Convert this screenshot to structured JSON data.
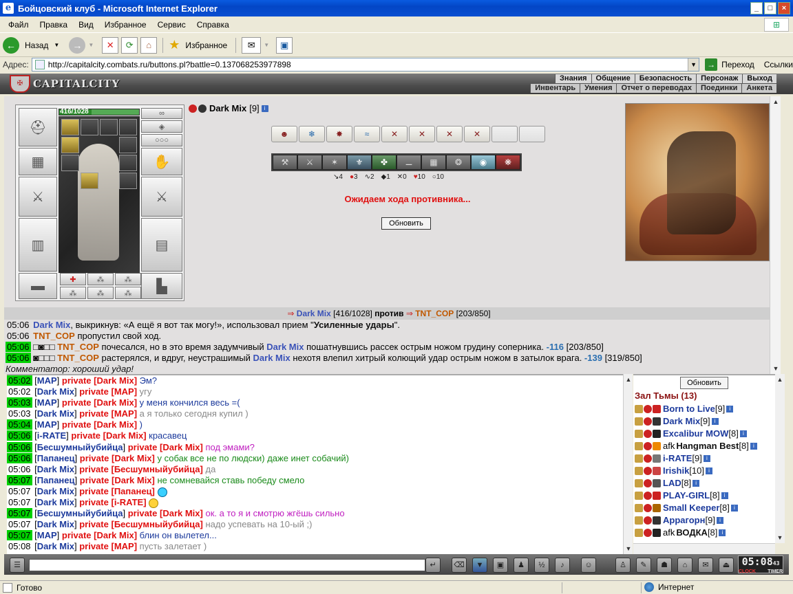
{
  "window": {
    "title": "Бойцовский клуб - Microsoft Internet Explorer"
  },
  "menu": [
    "Файл",
    "Правка",
    "Вид",
    "Избранное",
    "Сервис",
    "Справка"
  ],
  "toolbar": {
    "back_label": "Назад",
    "favorites_label": "Избранное"
  },
  "address": {
    "label": "Адрес:",
    "url": "http://capitalcity.combats.ru/buttons.pl?battle=0.137068253977898",
    "go_label": "Переход",
    "links_label": "Ссылки"
  },
  "game_header": {
    "logo_text": "CAPITALCITY",
    "nav_top": [
      "Знания",
      "Общение",
      "Безопасность",
      "Персонаж",
      "Выход"
    ],
    "nav_bottom": [
      "Инвентарь",
      "Умения",
      "Отчет о переводах",
      "Поединки",
      "Анкета"
    ]
  },
  "player": {
    "hp_text": "416/1028",
    "hp_fraction": 0.405,
    "name": "Dark Mix",
    "level": "[9]"
  },
  "counters": [
    "4",
    "3",
    "2",
    "1",
    "0",
    "10",
    "10"
  ],
  "status_message": "Ожидаем хода противника...",
  "refresh_label": "Обновить",
  "vs_bar": {
    "p1": "Dark Mix",
    "p1_hp": "[416/1028]",
    "vs": "против",
    "p2": "TNT_COP",
    "p2_hp": "[203/850]"
  },
  "battle_log": [
    {
      "time": "05:06",
      "hl": false,
      "parts": [
        [
          "blue",
          "Dark Mix"
        ],
        [
          "n",
          ", выкрикнув: «А ещё я вот так могу!», использовал прием \""
        ],
        [
          "dark",
          "Усиленные удары"
        ],
        [
          "n",
          "\"."
        ]
      ]
    },
    {
      "time": "05:06",
      "hl": false,
      "parts": [
        [
          "orange",
          "TNT_COP"
        ],
        [
          "n",
          " пропустил свой ход."
        ]
      ]
    },
    {
      "time": "05:06",
      "hl": true,
      "parts": [
        [
          "n",
          "□◙□□ "
        ],
        [
          "orange",
          "TNT_COP"
        ],
        [
          "n",
          " почесался, но в это время задумчивый "
        ],
        [
          "blue",
          "Dark Mix"
        ],
        [
          "n",
          " пошатнувшись рассек острым ножом грудину соперника. "
        ],
        [
          "cyan",
          "-116"
        ],
        [
          "n",
          " [203/850]"
        ]
      ]
    },
    {
      "time": "05:06",
      "hl": true,
      "parts": [
        [
          "n",
          "◙□□□ "
        ],
        [
          "orange",
          "TNT_COP"
        ],
        [
          "n",
          " растерялся, и вдруг, неустрашимый "
        ],
        [
          "blue",
          "Dark Mix"
        ],
        [
          "n",
          " нехотя влепил хитрый колющий удар острым ножом в затылок врага. "
        ],
        [
          "cyan",
          "-139"
        ],
        [
          "n",
          " [319/850]"
        ]
      ]
    }
  ],
  "commentator": "Комментатор: хороший удар!",
  "chat": [
    {
      "time": "05:02",
      "hl": true,
      "from": "MAP",
      "to": "Dark Mix",
      "msg": "Эм?",
      "color": "#1c3a9c",
      "smile": ""
    },
    {
      "time": "05:02",
      "hl": false,
      "from": "Dark Mix",
      "to": "MAP",
      "msg": "угу",
      "color": "#888",
      "smile": ""
    },
    {
      "time": "05:03",
      "hl": true,
      "from": "MAP",
      "to": "Dark Mix",
      "msg": "у меня кончился весь =(",
      "color": "#1c3a9c",
      "smile": ""
    },
    {
      "time": "05:03",
      "hl": false,
      "from": "Dark Mix",
      "to": "MAP",
      "msg": "а я только сегодня купил )",
      "color": "#888",
      "smile": ""
    },
    {
      "time": "05:04",
      "hl": true,
      "from": "MAP",
      "to": "Dark Mix",
      "msg": ")",
      "color": "#1c3a9c",
      "smile": ""
    },
    {
      "time": "05:06",
      "hl": true,
      "from": "i-RATE",
      "to": "Dark Mix",
      "msg": "красавец",
      "color": "#1c3a9c",
      "smile": ""
    },
    {
      "time": "05:06",
      "hl": true,
      "from": "Бесшумныйубийца",
      "to": "Dark Mix",
      "msg": "под эмами?",
      "color": "#c020c0",
      "smile": ""
    },
    {
      "time": "05:06",
      "hl": true,
      "from": "Папанец",
      "to": "Dark Mix",
      "msg": "у собак все не по людски) даже инет собачий)",
      "color": "#1a8a1a",
      "smile": ""
    },
    {
      "time": "05:06",
      "hl": false,
      "from": "Dark Mix",
      "to": "Бесшумныйубийца",
      "msg": "да",
      "color": "#888",
      "smile": ""
    },
    {
      "time": "05:07",
      "hl": true,
      "from": "Папанец",
      "to": "Dark Mix",
      "msg": "не сомневайся ставь победу смело",
      "color": "#1a8a1a",
      "smile": ""
    },
    {
      "time": "05:07",
      "hl": false,
      "from": "Dark Mix",
      "to": "Папанец",
      "msg": "",
      "color": "#888",
      "smile": "blue2"
    },
    {
      "time": "05:07",
      "hl": false,
      "from": "Dark Mix",
      "to": "i-RATE",
      "msg": "",
      "color": "#888",
      "smile": "yellow"
    },
    {
      "time": "05:07",
      "hl": true,
      "from": "Бесшумныйубийца",
      "to": "Dark Mix",
      "msg": "ок. а то я и смотрю жгёшь сильно",
      "color": "#c020c0",
      "smile": ""
    },
    {
      "time": "05:07",
      "hl": false,
      "from": "Dark Mix",
      "to": "Бесшумныйубийца",
      "msg": "надо успевать на 10-ый ;)",
      "color": "#888",
      "smile": ""
    },
    {
      "time": "05:07",
      "hl": true,
      "from": "MAP",
      "to": "Dark Mix",
      "msg": "блин он вылетел...",
      "color": "#1c3a9c",
      "smile": ""
    },
    {
      "time": "05:08",
      "hl": false,
      "from": "Dark Mix",
      "to": "MAP",
      "msg": "пусть залетает )",
      "color": "#888",
      "smile": ""
    }
  ],
  "chat_private_word": "private",
  "room": {
    "title": "Зал Тьмы (13)",
    "users": [
      {
        "name": "Born to Live",
        "level": "[9]",
        "afk": "",
        "black": false
      },
      {
        "name": "Dark Mix",
        "level": "[9]",
        "afk": "",
        "black": false
      },
      {
        "name": "Excalibur MOW",
        "level": "[8]",
        "afk": "",
        "black": false
      },
      {
        "name": "Hangman Best",
        "level": "[8]",
        "afk": "afk ",
        "black": true
      },
      {
        "name": "i-RATE",
        "level": "[9]",
        "afk": "",
        "black": false
      },
      {
        "name": "Irishik",
        "level": "[10]",
        "afk": "",
        "black": false
      },
      {
        "name": "LAD",
        "level": "[8]",
        "afk": "",
        "black": false
      },
      {
        "name": "PLAY-GIRL",
        "level": "[8]",
        "afk": "",
        "black": false
      },
      {
        "name": "Small Keeper",
        "level": "[8]",
        "afk": "",
        "black": false
      },
      {
        "name": "Аррагорн",
        "level": "[9]",
        "afk": "",
        "black": false
      },
      {
        "name": "ВОДКА",
        "level": "[8]",
        "afk": "afk ",
        "black": true
      }
    ]
  },
  "clock": {
    "time": "05:08",
    "sec": "43",
    "clock_label": "CLOCK",
    "timer_label": "TIMER"
  },
  "statusbar": {
    "left": "Готово",
    "zone": "Интернет"
  },
  "colors": {
    "highlight_green": "#00d000",
    "title_blue": "#0a4fd1",
    "alert_red": "#e01010"
  }
}
